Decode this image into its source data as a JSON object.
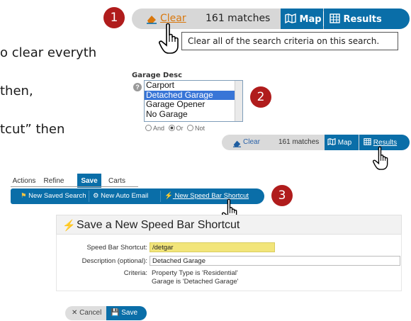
{
  "badges": [
    "1",
    "2",
    "3"
  ],
  "instructions": {
    "line1": "o clear everyth",
    "line2": "then,",
    "line3": "tcut” then"
  },
  "search_bar_large": {
    "clear_label": "Clear",
    "match_count": "161 matches",
    "map_label": "Map",
    "results_label": "Results"
  },
  "tooltip": "Clear all of the search criteria on this search.",
  "garage": {
    "label": "Garage Desc",
    "options": [
      "Carport",
      "Detached Garage",
      "Garage Opener",
      "No Garage"
    ],
    "selected": "Detached Garage",
    "radio_labels": [
      "And",
      "Or",
      "Not"
    ],
    "radio_selected": "Or"
  },
  "search_bar_small": {
    "clear_label": "Clear",
    "match_count": "161 matches",
    "map_label": "Map",
    "results_label": "Results"
  },
  "tabs": [
    "Actions",
    "Refine",
    "Save",
    "Carts"
  ],
  "active_tab": "Save",
  "actions": {
    "new_saved_search": "New Saved Search",
    "new_auto_email": "New Auto Email",
    "new_speed_bar": "New Speed Bar Shortcut"
  },
  "panel": {
    "title": "Save a New Speed Bar Shortcut",
    "shortcut_label": "Speed Bar Shortcut:",
    "shortcut_value": "/detgar",
    "description_label": "Description (optional):",
    "description_value": "Detached Garage",
    "criteria_label": "Criteria:",
    "criteria_line1": "Property Type is 'Residential'",
    "criteria_line2": "Garage is 'Detached Garage'"
  },
  "buttons": {
    "cancel": "Cancel",
    "save": "Save"
  },
  "colors": {
    "badge": "#b01c1c",
    "toolbar_blue": "#0a6ea8",
    "clear_orange": "#d9770c",
    "highlight_yellow": "#f2e57a",
    "selection_blue": "#3875d7"
  }
}
